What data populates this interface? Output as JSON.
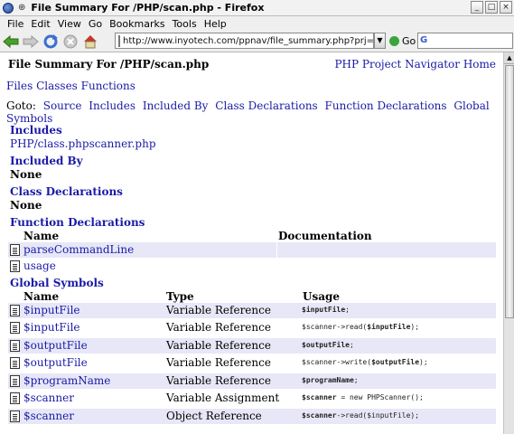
{
  "window": {
    "title": "File Summary For /PHP/scan.php - Firefox",
    "min_label": "_",
    "max_label": "□",
    "close_label": "×"
  },
  "menu": [
    "File",
    "Edit",
    "View",
    "Go",
    "Bookmarks",
    "Tools",
    "Help"
  ],
  "nav": {
    "url": "http://www.inyotech.com/ppnav/file_summary.php?prj=PHP_F",
    "go_label": "Go",
    "search_glyph": "G"
  },
  "page": {
    "heading": "File Summary For /PHP/scan.php",
    "project_link": "PHP Project Navigator Home",
    "tabs": "Files Classes Functions",
    "goto_label": "Goto:",
    "goto_links": [
      "Source",
      "Includes",
      "Included By",
      "Class Declarations",
      "Function Declarations",
      "Global Symbols"
    ],
    "includes_title": "Includes",
    "includes_value": "PHP/class.phpscanner.php",
    "included_by_title": "Included By",
    "included_by_value": "None",
    "class_decl_title": "Class Declarations",
    "class_decl_value": "None",
    "func_decl_title": "Function Declarations",
    "func_headers": {
      "name": "Name",
      "doc": "Documentation"
    },
    "functions": [
      "parseCommandLine",
      "usage"
    ],
    "globals_title": "Global Symbols",
    "global_headers": {
      "name": "Name",
      "type": "Type",
      "usage": "Usage"
    },
    "globals": [
      {
        "name": "$inputFile",
        "type": "Variable Reference",
        "usage_pre": "",
        "usage_bold": "$inputFile",
        "usage_post": ";"
      },
      {
        "name": "$inputFile",
        "type": "Variable Reference",
        "usage_pre": "$scanner->read(",
        "usage_bold": "$inputFile",
        "usage_post": ");"
      },
      {
        "name": "$outputFile",
        "type": "Variable Reference",
        "usage_pre": "",
        "usage_bold": "$outputFile",
        "usage_post": ";"
      },
      {
        "name": "$outputFile",
        "type": "Variable Reference",
        "usage_pre": "$scanner->write(",
        "usage_bold": "$outputFile",
        "usage_post": ");"
      },
      {
        "name": "$programName",
        "type": "Variable Reference",
        "usage_pre": "",
        "usage_bold": "$programName",
        "usage_post": ";"
      },
      {
        "name": "$scanner",
        "type": "Variable Assignment",
        "usage_pre": "",
        "usage_bold": "$scanner",
        "usage_post": " = new PHPScanner();"
      },
      {
        "name": "$scanner",
        "type": "Object Reference",
        "usage_pre": "",
        "usage_bold": "$scanner",
        "usage_post": "->read($inputFile);"
      }
    ]
  }
}
